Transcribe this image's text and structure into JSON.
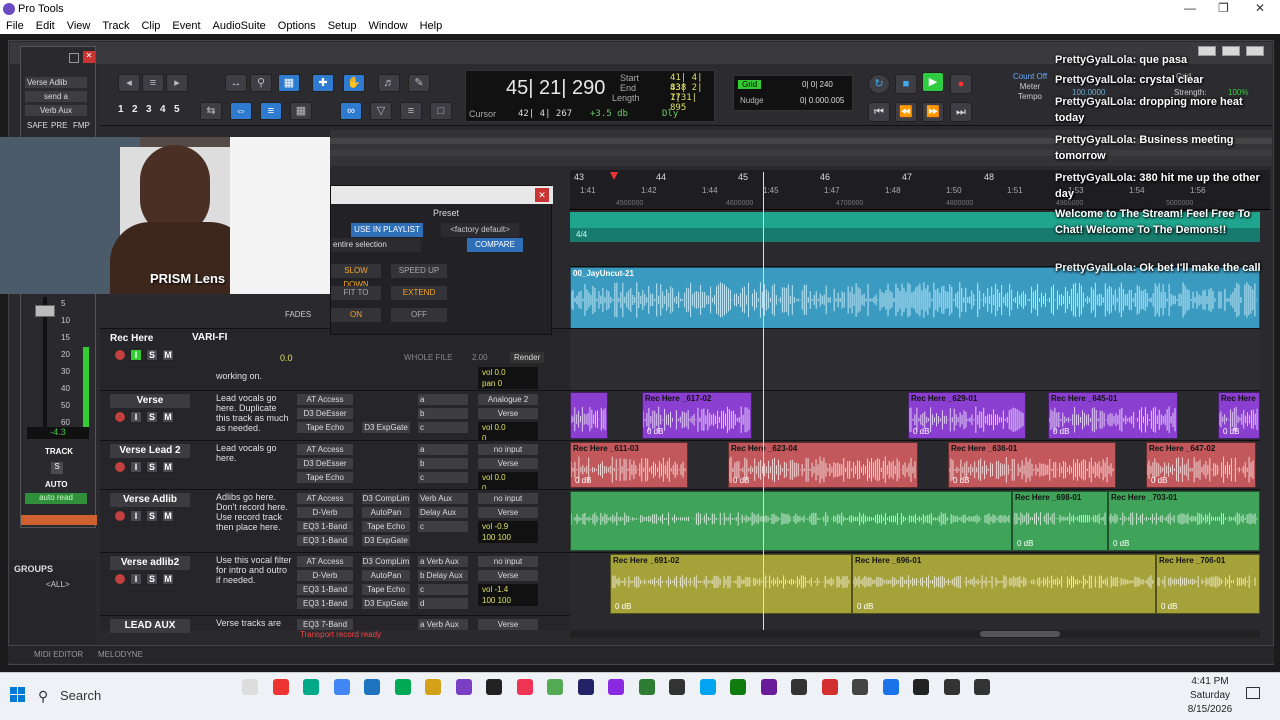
{
  "app": {
    "title": "Pro Tools"
  },
  "menu": [
    "File",
    "Edit",
    "View",
    "Track",
    "Clip",
    "Event",
    "AudioSuite",
    "Options",
    "Setup",
    "Window",
    "Help"
  ],
  "toolbar": {
    "zoom_presets": [
      "1",
      "2",
      "3",
      "4",
      "5"
    ],
    "counter_main": "45| 21| 290",
    "cursor_label": "Cursor",
    "cursor_value": "42| 4| 267",
    "db_value": "+3.5 db",
    "dly": "Dly",
    "start_label": "Start",
    "end_label": "End",
    "length_label": "Length",
    "start_value": "41| 4| 838",
    "end_value": "43| 2| 773",
    "length_value": "1| 1| 895",
    "grid_label": "Grid",
    "nudge_label": "Nudge",
    "grid_value": "0| 0| 240",
    "nudge_value": "0| 0.000.005",
    "count_off": "Count Off",
    "meter": "Meter",
    "tempo": "Tempo",
    "tempo_value": "100.0000",
    "grid_short": "Grid",
    "strength_label": "Strength:",
    "strength_value": "100%"
  },
  "strip": {
    "insert": "Verse Adlib",
    "send": "send a",
    "output": "Verb Aux",
    "safe": "SAFE",
    "pre": "PRE",
    "fmp": "FMP",
    "fader_value": "-4.3",
    "track_label": "TRACK",
    "solo": "S",
    "auto_label": "AUTO",
    "auto_mode": "auto read",
    "scale": [
      "5",
      "10",
      "15",
      "20",
      "30",
      "40",
      "50",
      "60"
    ]
  },
  "webcam": {
    "overlay_text": "PRISM Lens"
  },
  "plugin": {
    "preset_label": "Preset",
    "use_in_playlist": "USE IN PLAYLIST",
    "factory_default": "<factory default>",
    "entire_selection": "entire selection",
    "compare": "COMPARE",
    "slow_down": "SLOW DOWN",
    "speed_up": "SPEED UP",
    "fit_to": "FIT TO",
    "extend": "EXTEND",
    "fades_label": "FADES",
    "fades_on": "ON",
    "fades_off": "OFF"
  },
  "varifi": {
    "name": "VARI-FI",
    "value": "0.0",
    "whole_file": "WHOLE FILE",
    "amount": "2.00",
    "render": "Render"
  },
  "ruler": {
    "bars": [
      "43",
      "44",
      "45",
      "46",
      "47",
      "48"
    ],
    "minsecs": [
      "1:41",
      "1:42",
      "1:44",
      "1:45",
      "1:47",
      "1:48",
      "1:50",
      "1:51",
      "1:53",
      "1:54",
      "1:56"
    ],
    "samples": [
      "4500000",
      "4600000",
      "4700000",
      "4800000",
      "4900000",
      "5000000"
    ],
    "meter_value": "4/4"
  },
  "tracks": [
    {
      "name": "Rec Here",
      "comment": "working on.",
      "top_clip": "00_JayUncut-21",
      "vol": "0.0",
      "pan": "0"
    },
    {
      "name": "Verse",
      "comment": "Lead vocals go here. Duplicate this track as much as needed.",
      "inserts": [
        "AT Access",
        "D3 DeEsser",
        "Tape Echo"
      ],
      "ins2": [
        "",
        "",
        "D3 ExpGate"
      ],
      "sends": [
        "a",
        "b",
        "c"
      ],
      "io": [
        "Analogue 2",
        "Verse"
      ],
      "vol": "0.0",
      "pan": "0"
    },
    {
      "name": "Verse Lead 2",
      "comment": "Lead vocals go here.",
      "inserts": [
        "AT Access",
        "D3 DeEsser",
        "Tape Echo"
      ],
      "ins2": [
        "",
        "",
        ""
      ],
      "sends": [
        "a",
        "b",
        "c"
      ],
      "io": [
        "no input",
        "Verse"
      ],
      "vol": "0.0",
      "pan": "0"
    },
    {
      "name": "Verse Adlib",
      "comment": "Adlibs go here. Don't record here. Use record track then place here.",
      "inserts": [
        "AT Access",
        "D-Verb",
        "EQ3 1-Band",
        "EQ3 1-Band"
      ],
      "ins2": [
        "D3 CompLim",
        "AutoPan",
        "Tape Echo",
        "D3 ExpGate"
      ],
      "sends": [
        "Verb Aux",
        "Delay Aux",
        "c"
      ],
      "io": [
        "no input",
        "Verse"
      ],
      "vol": "-0.9",
      "pan": "100  100"
    },
    {
      "name": "Verse adlib2",
      "comment": "Use this vocal filter for intro and outro if needed.",
      "inserts": [
        "AT Access",
        "D-Verb",
        "EQ3 1-Band",
        "EQ3 1-Band"
      ],
      "ins2": [
        "D3 CompLim",
        "AutoPan",
        "Tape Echo",
        "D3 ExpGate"
      ],
      "sends": [
        "a Verb Aux",
        "b Delay Aux",
        "c",
        "d"
      ],
      "io": [
        "no input",
        "Verse"
      ],
      "vol": "-1.4",
      "pan": "100  100"
    },
    {
      "name": "LEAD AUX",
      "comment": "Verse tracks are",
      "inserts": [
        "EQ3 7-Band"
      ],
      "sends": [
        "a Verb Aux"
      ],
      "io": [
        "Verse"
      ]
    }
  ],
  "clips": {
    "verse": [
      {
        "name": "",
        "db": ""
      },
      {
        "name": "Rec Here _617-02",
        "db": "0 dB"
      },
      {
        "name": "Rec Here _629-01",
        "db": "0 dB"
      },
      {
        "name": "Rec Here _645-01",
        "db": "0 dB"
      },
      {
        "name": "Rec Here",
        "db": "0 dB"
      }
    ],
    "lead2": [
      {
        "name": "Rec Here _611-03",
        "db": "0 dB"
      },
      {
        "name": "Rec Here _623-04",
        "db": "0 dB"
      },
      {
        "name": "Rec Here _636-01",
        "db": "0 dB"
      },
      {
        "name": "Rec Here _647-02",
        "db": "0 dB"
      }
    ],
    "adlib": [
      {
        "name": "",
        "db": ""
      },
      {
        "name": "Rec Here _698-01",
        "db": "0 dB"
      },
      {
        "name": "Rec Here _703-01",
        "db": "0 dB"
      }
    ],
    "adlib2": [
      {
        "name": "Rec Here _691-02",
        "db": "0 dB"
      },
      {
        "name": "Rec Here _696-01",
        "db": "0 dB"
      },
      {
        "name": "Rec Here _706-01",
        "db": "0 dB"
      }
    ]
  },
  "status": {
    "transport_msg": "Transport record ready"
  },
  "groups": {
    "title": "GROUPS",
    "all": "<ALL>"
  },
  "bottom_tabs": [
    "MIDI EDITOR",
    "MELODYNE"
  ],
  "chat": [
    {
      "user": "PrettyGyalLola:",
      "msg": "que pasa"
    },
    {
      "user": "PrettyGyalLola:",
      "msg": "crystal clear"
    },
    {
      "user": "PrettyGyalLola:",
      "msg": "dropping more heat today"
    },
    {
      "user": "PrettyGyalLola:",
      "msg": "Business meeting tomorrow"
    },
    {
      "user": "PrettyGyalLola:",
      "msg": "380 hit me up the other day"
    },
    {
      "user": "",
      "msg": "Welcome to The Stream! Feel Free To Chat! Welcome To The Demons!!"
    },
    {
      "user": "PrettyGyalLola:",
      "msg": "Ok bet I'll make the call"
    }
  ],
  "taskbar": {
    "search_placeholder": "Search",
    "time": "4:41 PM",
    "day": "Saturday",
    "date": "8/15/2026"
  },
  "colors": {
    "verse": "#8a3fd0",
    "lead2": "#c2585b",
    "adlib": "#3fa45a",
    "adlib2": "#a6a23a",
    "top": "#3a9ac0",
    "accent": "#2f7bd0"
  }
}
